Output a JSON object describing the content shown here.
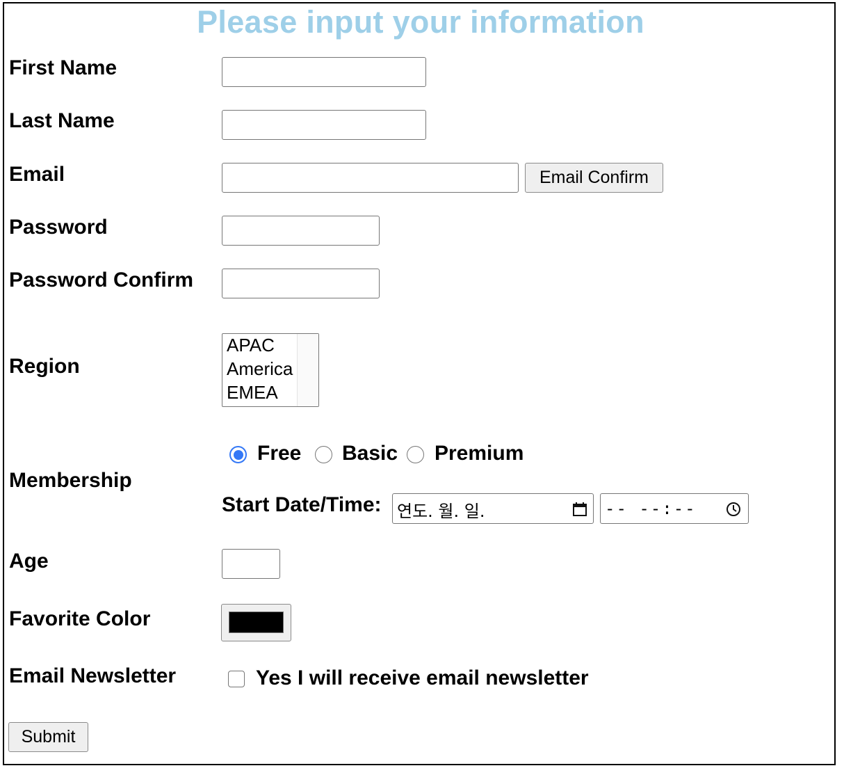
{
  "form": {
    "title": "Please input your information",
    "title_color": "#9ecfe8",
    "labels": {
      "first_name": "First Name",
      "last_name": "Last Name",
      "email": "Email",
      "password": "Password",
      "password_confirm": "Password Confirm",
      "region": "Region",
      "membership": "Membership",
      "age": "Age",
      "favorite_color": "Favorite Color",
      "email_newsletter": "Email Newsletter"
    },
    "inputs": {
      "first_name": "",
      "last_name": "",
      "email": "",
      "password": "",
      "password_confirm": "",
      "age": ""
    },
    "email_confirm_button": "Email Confirm",
    "region_options": [
      "APAC",
      "America",
      "EMEA"
    ],
    "membership_options": [
      {
        "label": "Free",
        "selected": true
      },
      {
        "label": "Basic",
        "selected": false
      },
      {
        "label": "Premium",
        "selected": false
      }
    ],
    "start_datetime_label": "Start Date/Time:",
    "date_placeholder": "연도. 월. 일.",
    "time_placeholder": "-- --:--",
    "date_icon": "calendar-icon",
    "time_icon": "clock-icon",
    "favorite_color_value": "#000000",
    "newsletter_checkbox_label": "Yes I will receive email newsletter",
    "newsletter_checked": false,
    "submit_label": "Submit",
    "accent_color": "#3478f6"
  }
}
